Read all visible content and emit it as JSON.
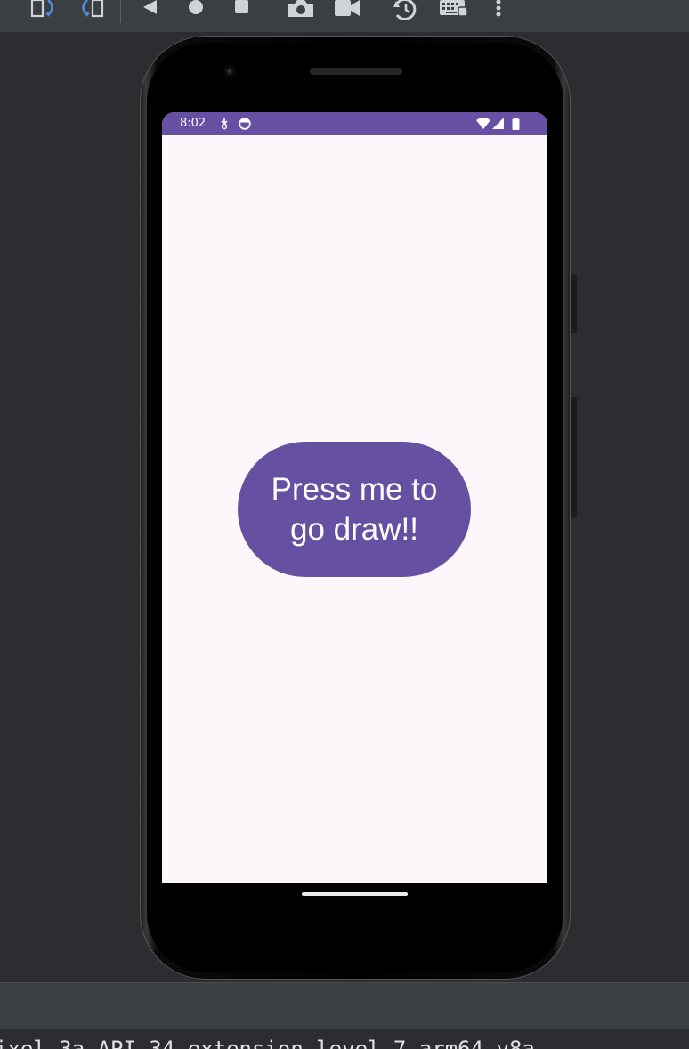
{
  "emulator": {
    "toolbar_icons": [
      "rotate-left-icon",
      "rotate-right-icon",
      "back-icon",
      "home-icon",
      "overview-icon",
      "screenshot-icon",
      "screen-record-icon",
      "snapshot-icon",
      "keyboard-icon",
      "more-options-icon"
    ],
    "device_label": "ixel 3a API 34 extension level 7 arm64-v8a"
  },
  "status_bar": {
    "time": "8:02",
    "left_icons": [
      "download-icon",
      "face-icon"
    ],
    "right_icons": [
      "wifi-icon",
      "cell-signal-icon",
      "battery-icon"
    ]
  },
  "app": {
    "button_label": "Press me to go draw!!"
  },
  "colors": {
    "accent": "#6750a4",
    "button": "#6550a2",
    "screen_background": "#fdf7fc",
    "ide_background": "#2b2d30"
  }
}
